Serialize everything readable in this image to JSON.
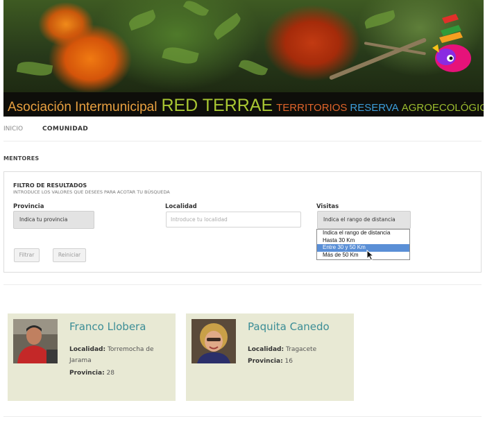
{
  "banner": {
    "org": "Asociación Intermunicipal",
    "red": "RED TERRAE",
    "territorios": "TERRITORIOS",
    "reserva": "RESERVA",
    "agro": "AGROECOLÓGICOS"
  },
  "nav": {
    "inicio": "INICIO",
    "comunidad": "COMUNIDAD"
  },
  "section_title": "MENTORES",
  "filter": {
    "title": "FILTRO DE RESULTADOS",
    "subtitle": "INTRODUCE LOS VALORES QUE DESEES PARA ACOTAR TU BÚSQUEDA",
    "provincia_label": "Provincia",
    "provincia_value": "Indica tu provincia",
    "localidad_label": "Localidad",
    "localidad_placeholder": "Introduce tu localidad",
    "visitas_label": "Visitas",
    "visitas_value": "Indica el rango de distancia",
    "filtrar": "Filtrar",
    "reiniciar": "Reiniciar",
    "visitas_options": [
      "Indica el rango de distancia",
      "Hasta 30 Km",
      "Entre 30 y 50 Km",
      "Más de 50 Km"
    ],
    "highlighted_option": "Entre 30 y 50 Km"
  },
  "mentors": [
    {
      "name": "Franco Llobera",
      "localidad_label": "Localidad:",
      "localidad": "Torremocha de Jarama",
      "provincia_label": "Provincia:",
      "provincia": "28"
    },
    {
      "name": "Paquita Canedo",
      "localidad_label": "Localidad:",
      "localidad": "Tragacete",
      "provincia_label": "Provincia:",
      "provincia": "16"
    }
  ],
  "colors": {
    "card_bg": "#e8e9d4",
    "name_color": "#3b8d96",
    "highlight": "#5a8fd6"
  }
}
